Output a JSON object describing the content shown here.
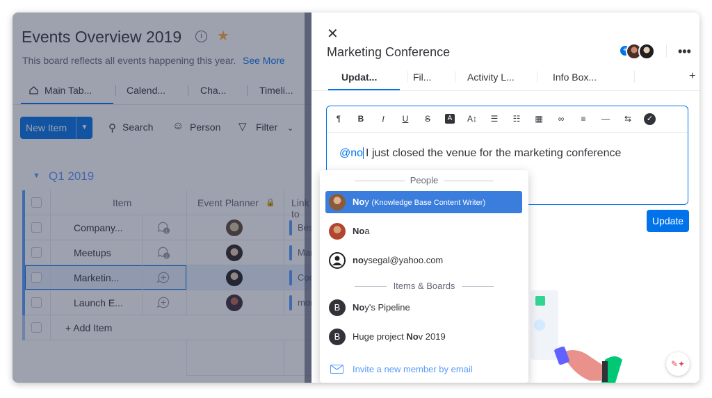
{
  "board": {
    "title": "Events Overview 2019",
    "description": "This board reflects all events happening this year.",
    "see_more": "See More",
    "tabs": [
      "Main Tab...",
      "Calend...",
      "Cha...",
      "Timeli..."
    ],
    "toolbar": {
      "new_item": "New Item",
      "search": "Search",
      "person": "Person",
      "filter": "Filter"
    },
    "group_title": "Q1 2019",
    "columns": {
      "item": "Item",
      "event_planner": "Event Planner",
      "link": "Link to"
    },
    "rows": [
      {
        "name": "Company...",
        "updates": "1",
        "link": "Best"
      },
      {
        "name": "Meetups",
        "updates": "2",
        "link": "Mark"
      },
      {
        "name": "Marketin...",
        "updates": "",
        "link": "Com"
      },
      {
        "name": "Launch E...",
        "updates": "",
        "link": "mon"
      }
    ],
    "add_item": "+ Add Item"
  },
  "panel": {
    "title": "Marketing Conference",
    "tabs": [
      "Updat...",
      "Fil...",
      "Activity L...",
      "Info Box..."
    ],
    "add_tab": "+",
    "editor": {
      "mention": "@no",
      "text": "I just closed the venue for the marketing conference"
    },
    "update_button": "Update",
    "dropdown": {
      "people_header": "People",
      "people": [
        {
          "bold": "No",
          "rest": "y",
          "sub_pre": "(",
          "sub_bold1": "K",
          "sub_mid1": "",
          "sub_bold2": "no",
          "sub_rest": "wledge Base Content Writer)",
          "subtitle": "(Knowledge Base Content Writer)",
          "active": true
        },
        {
          "bold": "No",
          "rest": "a",
          "active": false
        },
        {
          "bold": "no",
          "rest": "ysegal@yahoo.com",
          "active": false
        }
      ],
      "items_header": "Items & Boards",
      "items": [
        {
          "badge": "B",
          "pre": "",
          "bold": "No",
          "rest": "y's Pipeline"
        },
        {
          "badge": "B",
          "pre": "Huge project ",
          "bold": "No",
          "rest": "v 2019"
        }
      ],
      "invite": "Invite a new member by email"
    }
  },
  "colors": {
    "accent": "#0073ea",
    "group": "#579bfc",
    "overlay": "#292f4c",
    "star": "#fdab3d"
  }
}
